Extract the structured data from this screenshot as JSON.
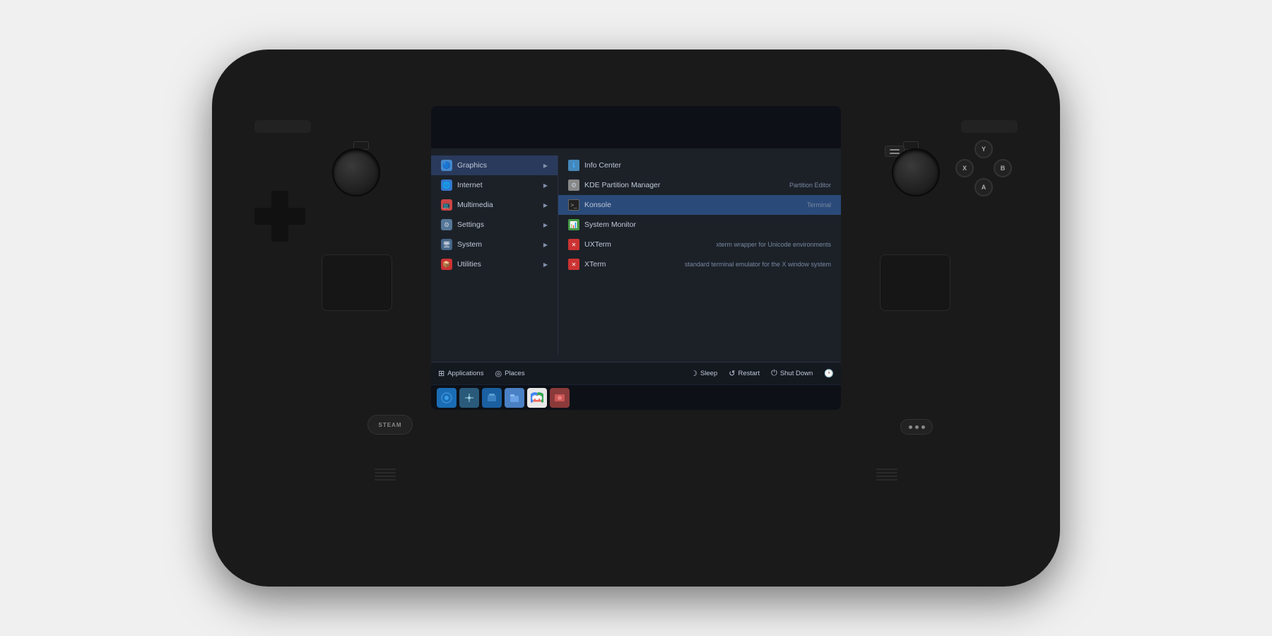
{
  "device": {
    "steam_label": "STEAM"
  },
  "screen": {
    "left_menu": {
      "items": [
        {
          "id": "graphics",
          "label": "Graphics",
          "icon": "🔵",
          "has_arrow": true,
          "active": true
        },
        {
          "id": "internet",
          "label": "Internet",
          "icon": "🌐",
          "has_arrow": true
        },
        {
          "id": "multimedia",
          "label": "Multimedia",
          "icon": "📺",
          "has_arrow": true
        },
        {
          "id": "settings",
          "label": "Settings",
          "icon": "⚙",
          "has_arrow": true
        },
        {
          "id": "system",
          "label": "System",
          "icon": "🖥",
          "has_arrow": true
        },
        {
          "id": "utilities",
          "label": "Utilities",
          "icon": "📦",
          "has_arrow": true
        }
      ]
    },
    "right_menu": {
      "items": [
        {
          "id": "info-center",
          "label": "Info Center",
          "icon": "ℹ",
          "desc": ""
        },
        {
          "id": "kde-partition",
          "label": "KDE Partition Manager",
          "icon": "⚙",
          "desc": "Partition Editor"
        },
        {
          "id": "konsole",
          "label": "Konsole",
          "icon": ">_",
          "desc": "Terminal",
          "selected": true
        },
        {
          "id": "system-monitor",
          "label": "System Monitor",
          "icon": "📊",
          "desc": ""
        },
        {
          "id": "uxterm",
          "label": "UXTerm",
          "icon": "✕",
          "desc": "xterm wrapper for Unicode environments"
        },
        {
          "id": "xterm",
          "label": "XTerm",
          "icon": "✕",
          "desc": "standard terminal emulator for the X window system"
        }
      ]
    },
    "bottom_bar": {
      "items": [
        {
          "id": "applications",
          "label": "Applications",
          "icon": "⊞"
        },
        {
          "id": "places",
          "label": "Places",
          "icon": "◎"
        },
        {
          "id": "sleep",
          "label": "Sleep",
          "icon": "☽"
        },
        {
          "id": "restart",
          "label": "Restart",
          "icon": "↺"
        },
        {
          "id": "shutdown",
          "label": "Shut Down",
          "icon": "⏻"
        },
        {
          "id": "clock",
          "label": "",
          "icon": "🕐"
        }
      ]
    },
    "taskbar": {
      "icons": [
        {
          "id": "discover",
          "color": "#1a6db5",
          "label": "Discover"
        },
        {
          "id": "network",
          "color": "#3a7a9c",
          "label": "Network"
        },
        {
          "id": "store",
          "color": "#1a5fa0",
          "label": "Store"
        },
        {
          "id": "files",
          "color": "#4a90d9",
          "label": "Files"
        },
        {
          "id": "chrome",
          "color": "#e8e8e8",
          "label": "Chrome"
        },
        {
          "id": "screenshot",
          "color": "#cc6655",
          "label": "Screenshot"
        }
      ]
    }
  },
  "face_buttons": {
    "Y": "Y",
    "B": "B",
    "A": "A",
    "X": "X"
  }
}
